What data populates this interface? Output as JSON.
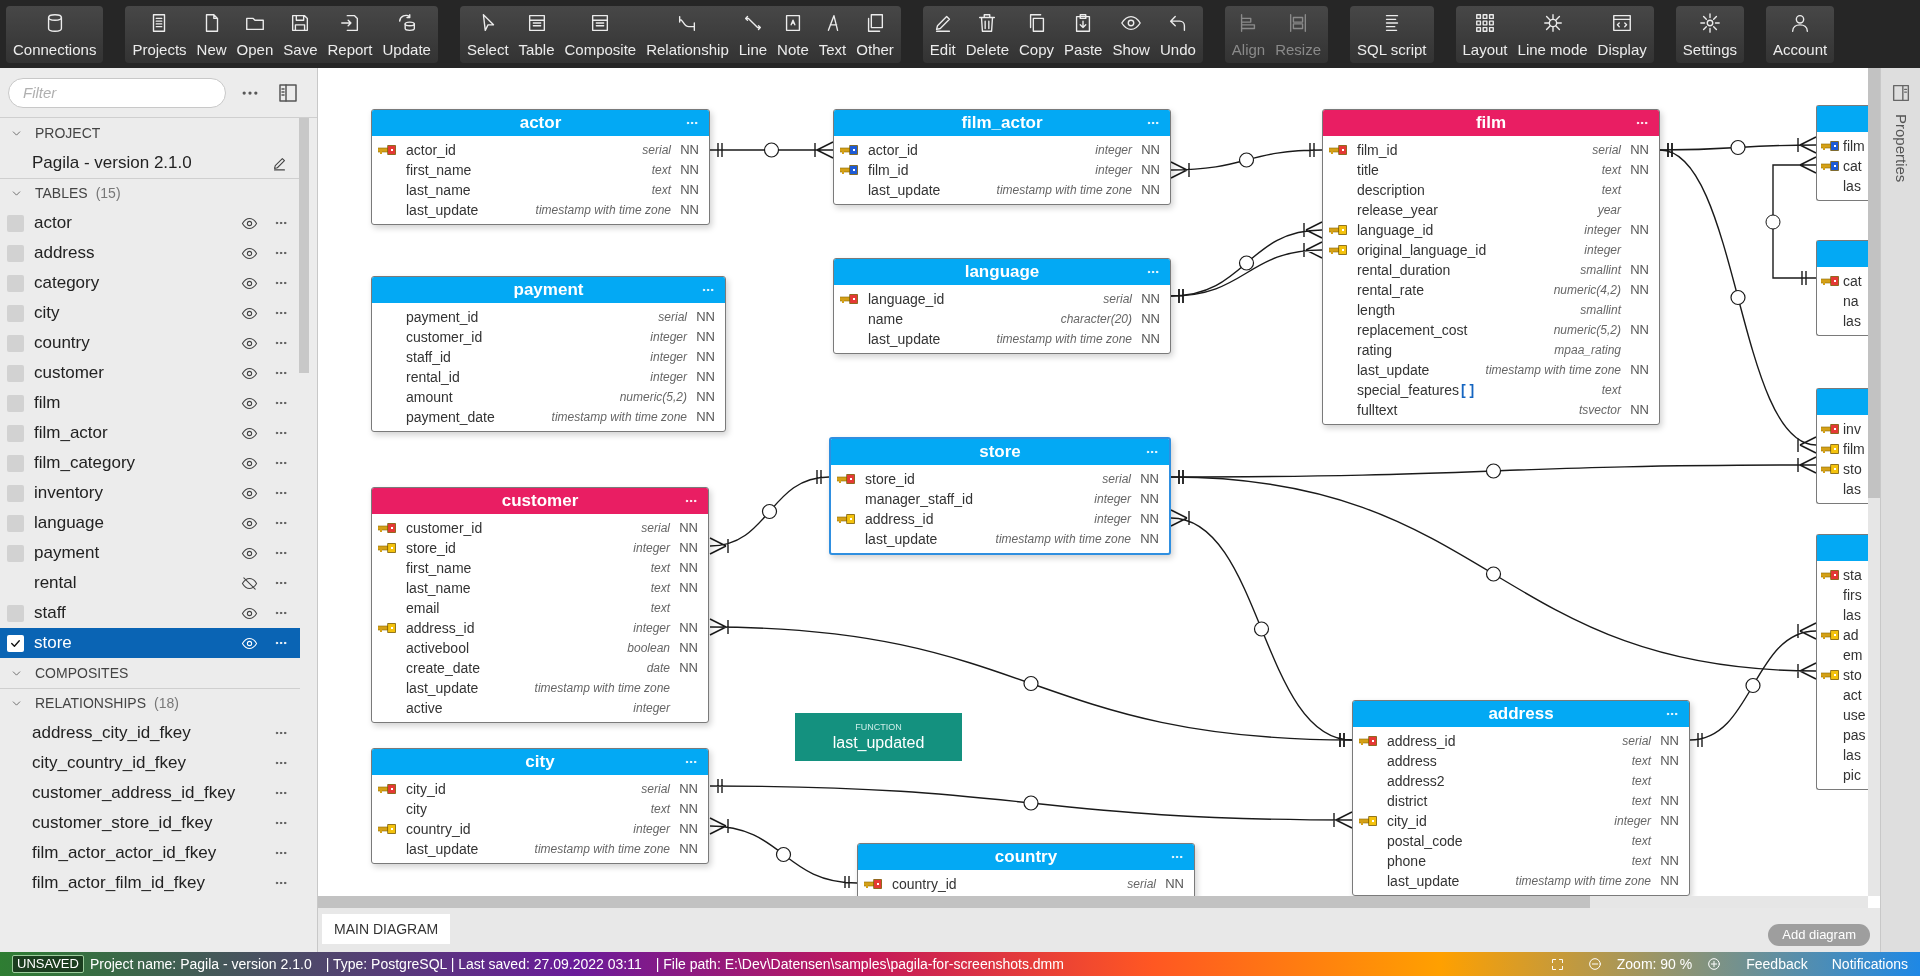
{
  "toolbar": {
    "groups": [
      {
        "buttons": [
          {
            "label": "Connections",
            "disabled": false
          }
        ]
      },
      {
        "buttons": [
          {
            "label": "Projects",
            "disabled": false
          },
          {
            "label": "New",
            "disabled": false
          },
          {
            "label": "Open",
            "disabled": false
          },
          {
            "label": "Save",
            "disabled": false
          },
          {
            "label": "Report",
            "disabled": false
          },
          {
            "label": "Update",
            "disabled": false
          }
        ]
      },
      {
        "buttons": [
          {
            "label": "Select",
            "disabled": false
          },
          {
            "label": "Table",
            "disabled": false
          },
          {
            "label": "Composite",
            "disabled": false
          },
          {
            "label": "Relationship",
            "disabled": false
          },
          {
            "label": "Line",
            "disabled": false
          },
          {
            "label": "Note",
            "disabled": false
          },
          {
            "label": "Text",
            "disabled": false
          },
          {
            "label": "Other",
            "disabled": false
          }
        ]
      },
      {
        "buttons": [
          {
            "label": "Edit",
            "disabled": false
          },
          {
            "label": "Delete",
            "disabled": false
          },
          {
            "label": "Copy",
            "disabled": false
          },
          {
            "label": "Paste",
            "disabled": false
          },
          {
            "label": "Show",
            "disabled": false
          },
          {
            "label": "Undo",
            "disabled": false
          }
        ]
      },
      {
        "buttons": [
          {
            "label": "Align",
            "disabled": true
          },
          {
            "label": "Resize",
            "disabled": true
          }
        ]
      },
      {
        "buttons": [
          {
            "label": "SQL script",
            "disabled": false
          }
        ]
      },
      {
        "buttons": [
          {
            "label": "Layout",
            "disabled": false
          },
          {
            "label": "Line mode",
            "disabled": false
          },
          {
            "label": "Display",
            "disabled": false
          }
        ]
      },
      {
        "buttons": [
          {
            "label": "Settings",
            "disabled": false
          }
        ]
      },
      {
        "buttons": [
          {
            "label": "Account",
            "disabled": false
          }
        ]
      }
    ]
  },
  "sidebar": {
    "filter": {
      "placeholder": "Filter"
    },
    "project": {
      "title": "PROJECT",
      "expanded": true,
      "name": "Pagila - version 2.1.0"
    },
    "tables": {
      "title": "TABLES",
      "count": "(15)",
      "expanded": true,
      "items": [
        {
          "name": "actor",
          "checked": false,
          "visible": true,
          "selected": false
        },
        {
          "name": "address",
          "checked": false,
          "visible": true,
          "selected": false
        },
        {
          "name": "category",
          "checked": false,
          "visible": true,
          "selected": false
        },
        {
          "name": "city",
          "checked": false,
          "visible": true,
          "selected": false
        },
        {
          "name": "country",
          "checked": false,
          "visible": true,
          "selected": false
        },
        {
          "name": "customer",
          "checked": false,
          "visible": true,
          "selected": false
        },
        {
          "name": "film",
          "checked": false,
          "visible": true,
          "selected": false
        },
        {
          "name": "film_actor",
          "checked": false,
          "visible": true,
          "selected": false
        },
        {
          "name": "film_category",
          "checked": false,
          "visible": true,
          "selected": false
        },
        {
          "name": "inventory",
          "checked": false,
          "visible": true,
          "selected": false
        },
        {
          "name": "language",
          "checked": false,
          "visible": true,
          "selected": false
        },
        {
          "name": "payment",
          "checked": false,
          "visible": true,
          "selected": false
        },
        {
          "name": "rental",
          "checked": false,
          "visible": false,
          "selected": false
        },
        {
          "name": "staff",
          "checked": false,
          "visible": true,
          "selected": false
        },
        {
          "name": "store",
          "checked": true,
          "visible": true,
          "selected": true
        }
      ]
    },
    "composites": {
      "title": "COMPOSITES",
      "expanded": true
    },
    "relationships": {
      "title": "RELATIONSHIPS",
      "count": "(18)",
      "expanded": true,
      "items": [
        {
          "name": "address_city_id_fkey"
        },
        {
          "name": "city_country_id_fkey"
        },
        {
          "name": "customer_address_id_fkey"
        },
        {
          "name": "customer_store_id_fkey"
        },
        {
          "name": "film_actor_actor_id_fkey"
        },
        {
          "name": "film_actor_film_id_fkey"
        }
      ]
    }
  },
  "diagram": {
    "tables": [
      {
        "name": "actor",
        "color": "#03a9f4",
        "selected": false,
        "columns": [
          {
            "name": "actor_id",
            "type": "serial",
            "nn": "NN",
            "kind": "primary"
          },
          {
            "name": "first_name",
            "type": "text",
            "nn": "NN"
          },
          {
            "name": "last_name",
            "type": "text",
            "nn": "NN"
          },
          {
            "name": "last_update",
            "type": "timestamp with time zone",
            "nn": "NN"
          }
        ]
      },
      {
        "name": "film_actor",
        "color": "#03a9f4",
        "selected": false,
        "columns": [
          {
            "name": "actor_id",
            "type": "integer",
            "nn": "NN",
            "kind": "shared"
          },
          {
            "name": "film_id",
            "type": "integer",
            "nn": "NN",
            "kind": "shared"
          },
          {
            "name": "last_update",
            "type": "timestamp with time zone",
            "nn": "NN"
          }
        ]
      },
      {
        "name": "film",
        "color": "#e91e63",
        "selected": false,
        "columns": [
          {
            "name": "film_id",
            "type": "serial",
            "nn": "NN",
            "kind": "primary"
          },
          {
            "name": "title",
            "type": "text",
            "nn": "NN"
          },
          {
            "name": "description",
            "type": "text"
          },
          {
            "name": "release_year",
            "type": "year"
          },
          {
            "name": "language_id",
            "type": "integer",
            "nn": "NN",
            "kind": "foreign"
          },
          {
            "name": "original_language_id",
            "type": "integer",
            "kind": "foreign"
          },
          {
            "name": "rental_duration",
            "type": "smallint",
            "nn": "NN"
          },
          {
            "name": "rental_rate",
            "type": "numeric(4,2)",
            "nn": "NN"
          },
          {
            "name": "length",
            "type": "smallint"
          },
          {
            "name": "replacement_cost",
            "type": "numeric(5,2)",
            "nn": "NN"
          },
          {
            "name": "rating",
            "type": "mpaa_rating"
          },
          {
            "name": "last_update",
            "type": "timestamp with time zone",
            "nn": "NN"
          },
          {
            "name": "special_features",
            "suffix": "[ ]",
            "type": "text"
          },
          {
            "name": "fulltext",
            "type": "tsvector",
            "nn": "NN"
          }
        ]
      },
      {
        "name": "payment",
        "color": "#03a9f4",
        "selected": false,
        "columns": [
          {
            "name": "payment_id",
            "type": "serial",
            "nn": "NN"
          },
          {
            "name": "customer_id",
            "type": "integer",
            "nn": "NN"
          },
          {
            "name": "staff_id",
            "type": "integer",
            "nn": "NN"
          },
          {
            "name": "rental_id",
            "type": "integer",
            "nn": "NN"
          },
          {
            "name": "amount",
            "type": "numeric(5,2)",
            "nn": "NN"
          },
          {
            "name": "payment_date",
            "type": "timestamp with time zone",
            "nn": "NN"
          }
        ]
      },
      {
        "name": "language",
        "color": "#03a9f4",
        "selected": false,
        "columns": [
          {
            "name": "language_id",
            "type": "serial",
            "nn": "NN",
            "kind": "primary"
          },
          {
            "name": "name",
            "type": "character(20)",
            "nn": "NN"
          },
          {
            "name": "last_update",
            "type": "timestamp with time zone",
            "nn": "NN"
          }
        ]
      },
      {
        "name": "store",
        "color": "#03a9f4",
        "selected": true,
        "columns": [
          {
            "name": "store_id",
            "type": "serial",
            "nn": "NN",
            "kind": "primary"
          },
          {
            "name": "manager_staff_id",
            "type": "integer",
            "nn": "NN"
          },
          {
            "name": "address_id",
            "type": "integer",
            "nn": "NN",
            "kind": "foreign"
          },
          {
            "name": "last_update",
            "type": "timestamp with time zone",
            "nn": "NN"
          }
        ]
      },
      {
        "name": "customer",
        "color": "#e91e63",
        "selected": false,
        "columns": [
          {
            "name": "customer_id",
            "type": "serial",
            "nn": "NN",
            "kind": "primary"
          },
          {
            "name": "store_id",
            "type": "integer",
            "nn": "NN",
            "kind": "foreign"
          },
          {
            "name": "first_name",
            "type": "text",
            "nn": "NN"
          },
          {
            "name": "last_name",
            "type": "text",
            "nn": "NN"
          },
          {
            "name": "email",
            "type": "text"
          },
          {
            "name": "address_id",
            "type": "integer",
            "nn": "NN",
            "kind": "foreign"
          },
          {
            "name": "activebool",
            "type": "boolean",
            "nn": "NN"
          },
          {
            "name": "create_date",
            "type": "date",
            "nn": "NN"
          },
          {
            "name": "last_update",
            "type": "timestamp with time zone"
          },
          {
            "name": "active",
            "type": "integer"
          }
        ]
      },
      {
        "name": "city",
        "color": "#03a9f4",
        "selected": false,
        "columns": [
          {
            "name": "city_id",
            "type": "serial",
            "nn": "NN",
            "kind": "primary"
          },
          {
            "name": "city",
            "type": "text",
            "nn": "NN"
          },
          {
            "name": "country_id",
            "type": "integer",
            "nn": "NN",
            "kind": "foreign"
          },
          {
            "name": "last_update",
            "type": "timestamp with time zone",
            "nn": "NN"
          }
        ]
      },
      {
        "name": "country",
        "color": "#03a9f4",
        "selected": false,
        "columns": [
          {
            "name": "country_id",
            "type": "serial",
            "nn": "NN",
            "kind": "primary"
          }
        ]
      },
      {
        "name": "address",
        "color": "#03a9f4",
        "selected": false,
        "columns": [
          {
            "name": "address_id",
            "type": "serial",
            "nn": "NN",
            "kind": "primary"
          },
          {
            "name": "address",
            "type": "text",
            "nn": "NN"
          },
          {
            "name": "address2",
            "type": "text"
          },
          {
            "name": "district",
            "type": "text",
            "nn": "NN"
          },
          {
            "name": "city_id",
            "type": "integer",
            "nn": "NN",
            "kind": "foreign"
          },
          {
            "name": "postal_code",
            "type": "text"
          },
          {
            "name": "phone",
            "type": "text",
            "nn": "NN"
          },
          {
            "name": "last_update",
            "type": "timestamp with time zone",
            "nn": "NN"
          }
        ]
      }
    ],
    "cut_tables": [
      {
        "columns": [
          {
            "name": "film",
            "kind": "shared"
          },
          {
            "name": "cat",
            "kind": "shared"
          },
          {
            "name": "las"
          }
        ]
      },
      {
        "columns": [
          {
            "name": "cat",
            "kind": "primary"
          },
          {
            "name": "na"
          },
          {
            "name": "las"
          }
        ]
      },
      {
        "columns": [
          {
            "name": "inv",
            "kind": "primary"
          },
          {
            "name": "film",
            "kind": "foreign"
          },
          {
            "name": "sto",
            "kind": "foreign"
          },
          {
            "name": "las"
          }
        ]
      },
      {
        "columns": [
          {
            "name": "sta",
            "kind": "primary"
          },
          {
            "name": "firs"
          },
          {
            "name": "las"
          },
          {
            "name": "ad",
            "kind": "foreign"
          },
          {
            "name": "em"
          },
          {
            "name": "sto",
            "kind": "foreign"
          },
          {
            "name": "act"
          },
          {
            "name": "use"
          },
          {
            "name": "pas"
          },
          {
            "name": "las"
          },
          {
            "name": "pic"
          }
        ]
      }
    ],
    "notes": [
      {
        "kind": "function",
        "label": "FUNCTION",
        "name": "last_updated"
      }
    ]
  },
  "properties_panel": {
    "title": "Properties"
  },
  "tabs": [
    {
      "label": "MAIN DIAGRAM",
      "selected": true
    }
  ],
  "add_diagram": "Add diagram",
  "status_bar": {
    "state": "UNSAVED",
    "project": "Project name: Pagila - version 2.1.0",
    "type": "| Type: PostgreSQL | Last saved: 27.09.2022 03:11",
    "file": "| File path: E:\\Dev\\Datensen\\samples\\pagila-for-screenshots.dmm",
    "zoom": "Zoom: 90 %",
    "feedback": "Feedback",
    "notifications": "Notifications"
  }
}
